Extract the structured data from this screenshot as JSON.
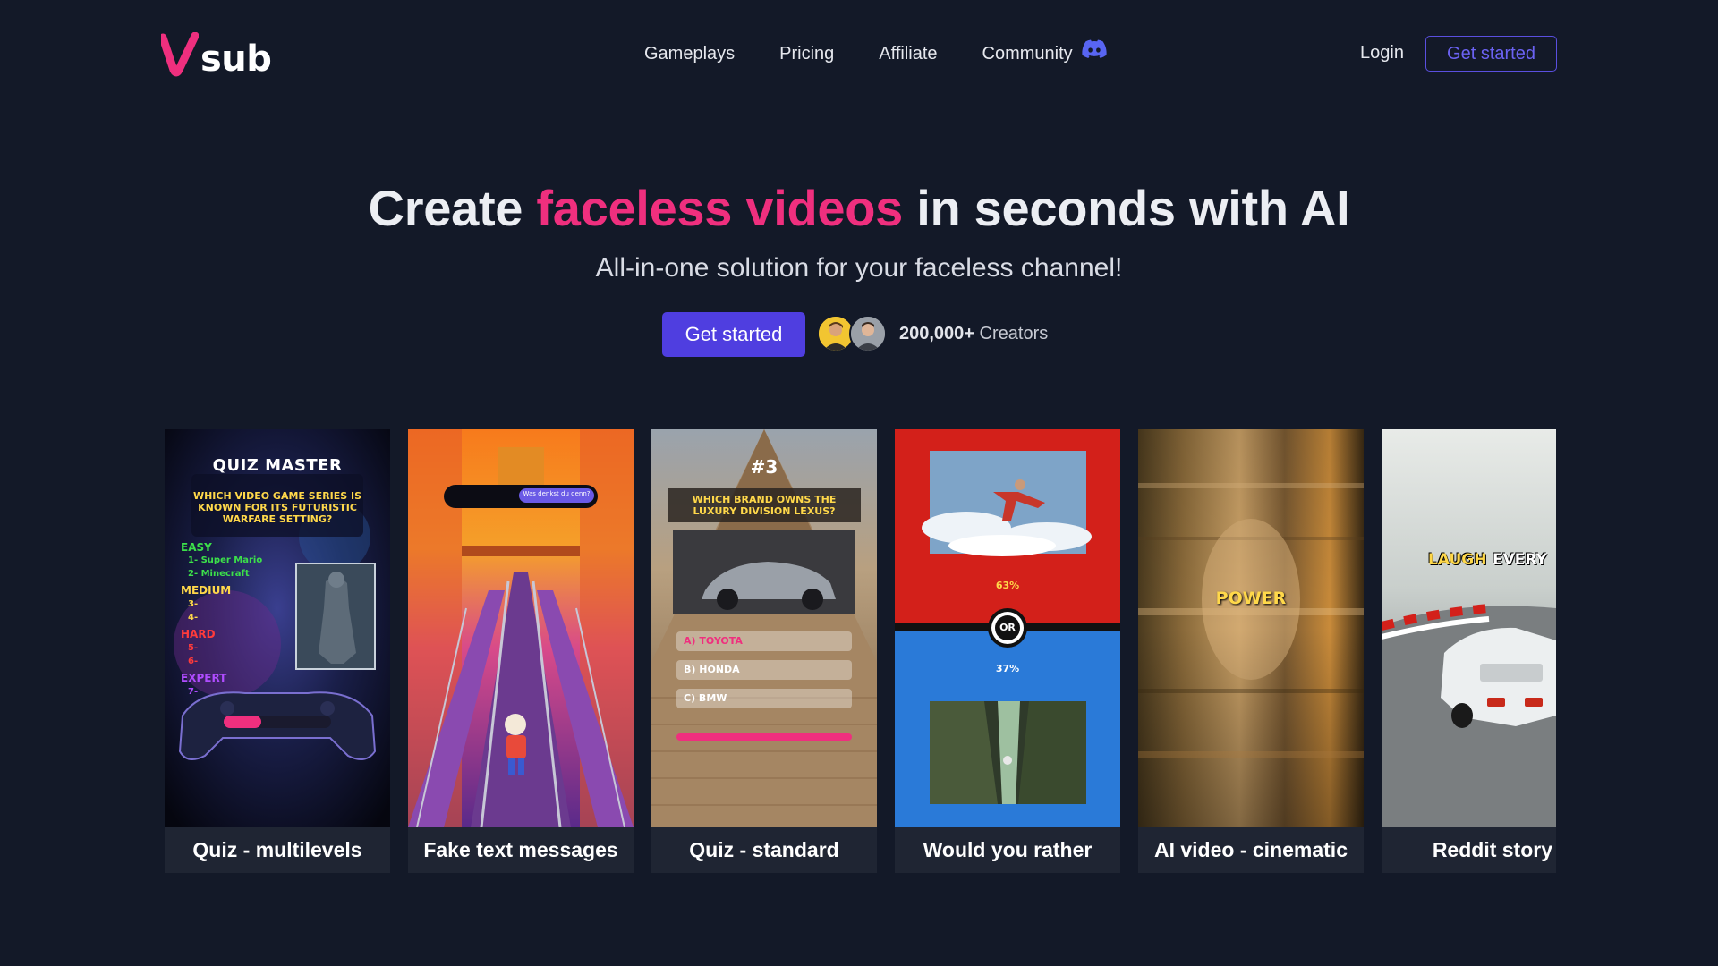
{
  "nav": {
    "brand_mark": "V",
    "brand_text": "sub",
    "links": [
      "Gameplays",
      "Pricing",
      "Affiliate",
      "Community"
    ],
    "login": "Login",
    "cta": "Get started"
  },
  "hero": {
    "title_prefix": "Create",
    "title_accent": "faceless videos",
    "title_suffix": "in seconds with AI",
    "subtitle": "All-in-one solution for your faceless channel!",
    "cta": "Get started",
    "creators_count": "200,000+",
    "creators_label": "Creators"
  },
  "cards": [
    {
      "caption": "Quiz - multilevels",
      "overlay": {
        "title": "QUIZ MASTER",
        "question_1": "WHICH VIDEO GAME SERIES IS",
        "question_2": "KNOWN FOR ITS FUTURISTIC",
        "question_3": "WARFARE SETTING?",
        "level_easy": "EASY",
        "answer_1": "1- Super Mario",
        "answer_2": "2- Minecraft",
        "level_medium": "MEDIUM",
        "slot_3": "3-",
        "slot_4": "4-",
        "level_hard": "HARD",
        "slot_5": "5-",
        "slot_6": "6-",
        "level_expert": "EXPERT",
        "slot_7": "7-"
      }
    },
    {
      "caption": "Fake text messages",
      "overlay": {
        "message": "Was denkst du denn?"
      }
    },
    {
      "caption": "Quiz - standard",
      "overlay": {
        "number": "#3",
        "question_1": "WHICH BRAND OWNS THE",
        "question_2": "LUXURY DIVISION LEXUS?",
        "option_a": "A) TOYOTA",
        "option_b": "B) HONDA",
        "option_c": "C) BMW"
      }
    },
    {
      "caption": "Would you rather",
      "overlay": {
        "top_percent": "63%",
        "or": "OR",
        "bottom_percent": "37%"
      }
    },
    {
      "caption": "AI video - cinematic",
      "overlay": {
        "word": "POWER"
      }
    },
    {
      "caption": "Reddit story",
      "overlay": {
        "word_1": "LAUGH",
        "word_2": "EVERY"
      }
    }
  ],
  "colors": {
    "background": "#131928",
    "accent_pink": "#ef2f7e",
    "primary_purple": "#4f3ee0",
    "discord": "#5865f2"
  },
  "icons": [
    "vsub-logo-icon",
    "discord-icon"
  ]
}
